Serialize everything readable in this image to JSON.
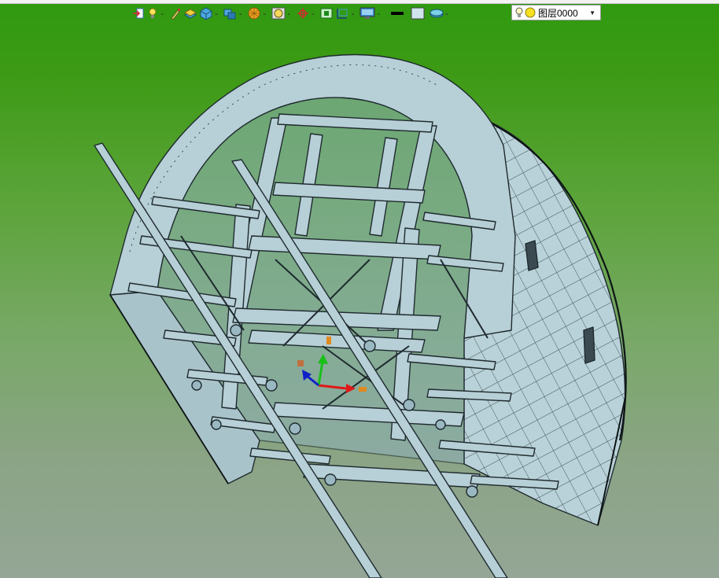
{
  "toolbar": {
    "layer_name": "图层0000",
    "dropdown_glyph": "⌄",
    "buttons": [
      {
        "name": "import-icon"
      },
      {
        "name": "light-bulb-icon",
        "dropdown": true
      },
      {
        "name": "brush-icon"
      },
      {
        "name": "layers-stack-icon"
      },
      {
        "name": "cube-icon",
        "dropdown": true
      },
      {
        "name": "box-stack-icon",
        "dropdown": true
      },
      {
        "name": "render-sphere-icon",
        "dropdown": true
      },
      {
        "name": "zoom-view-icon",
        "dropdown": true
      },
      {
        "name": "rotate-origin-icon",
        "dropdown": true
      },
      {
        "name": "fit-view-icon"
      },
      {
        "name": "view-frame-icon",
        "dropdown": true
      },
      {
        "name": "display-monitor-icon",
        "dropdown": true
      },
      {
        "name": "line-color-swatch"
      },
      {
        "name": "fill-color-swatch"
      },
      {
        "name": "layer-disc-icon",
        "dropdown": true
      }
    ]
  },
  "colors": {
    "model_fill": "#b7cfd6",
    "model_stroke": "#1e2a2e",
    "axis_x": "#e01818",
    "axis_y": "#18c018",
    "axis_z": "#1020c8",
    "handle": "#e08a20",
    "bg_top": "#2f9a10",
    "bg_bottom": "#94a696"
  }
}
